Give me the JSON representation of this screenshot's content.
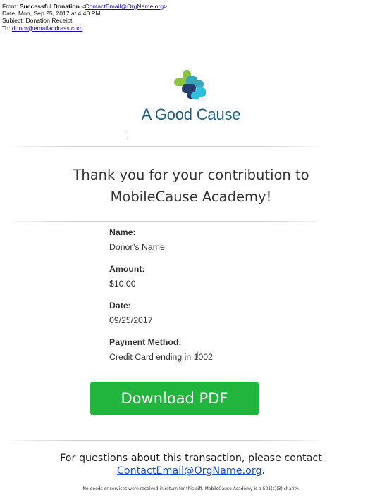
{
  "email_header": {
    "from_label": "From:",
    "from_name": "Successful Donation",
    "from_email": "ContactEmail@OrgName.org",
    "date_label": "Date:",
    "date_value": "Mon, Sep 25, 2017 at 4:40 PM",
    "subject_label": "Subject:",
    "subject_value": "Donation Receipt",
    "to_label": "To:",
    "to_email": "donor@emailaddress.com"
  },
  "org": {
    "name": "A Good Cause",
    "logo_icon": "puzzle-cross-logo",
    "colors": {
      "green": "#8bc540",
      "teal": "#3aa6b9",
      "navy": "#233f6e",
      "blue": "#1f5f86"
    }
  },
  "receipt": {
    "thanks_line1": "Thank you for your contribution to",
    "thanks_line2": "MobileCause Academy!",
    "fields": [
      {
        "label": "Name:",
        "value": "Donor’s Name"
      },
      {
        "label": "Amount:",
        "value": "$10.00"
      },
      {
        "label": "Date:",
        "value": "09/25/2017"
      },
      {
        "label": "Payment Method:",
        "value": "Credit Card ending in 1002"
      }
    ],
    "download_label": "Download PDF",
    "button_color": "#21b53e"
  },
  "footer": {
    "questions_text": "For questions about this transaction, please contact",
    "contact_email": "ContactEmail@OrgName.org",
    "period": ".",
    "fine_print": "No goods or services were received in return for this gift. MobileCause Academy is a 501(c)(3) charity."
  }
}
